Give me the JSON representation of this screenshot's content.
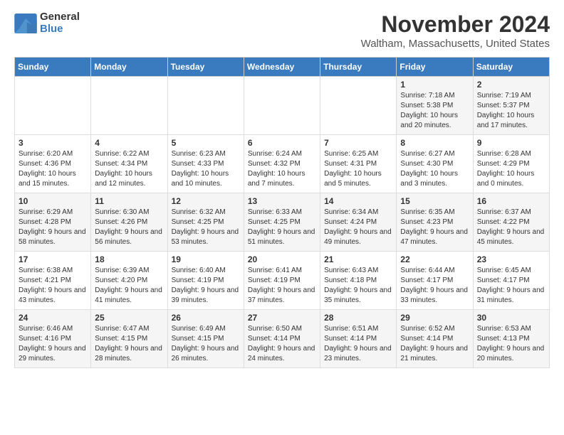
{
  "logo": {
    "general": "General",
    "blue": "Blue"
  },
  "title": "November 2024",
  "location": "Waltham, Massachusetts, United States",
  "days_of_week": [
    "Sunday",
    "Monday",
    "Tuesday",
    "Wednesday",
    "Thursday",
    "Friday",
    "Saturday"
  ],
  "weeks": [
    [
      {
        "num": "",
        "info": ""
      },
      {
        "num": "",
        "info": ""
      },
      {
        "num": "",
        "info": ""
      },
      {
        "num": "",
        "info": ""
      },
      {
        "num": "",
        "info": ""
      },
      {
        "num": "1",
        "info": "Sunrise: 7:18 AM\nSunset: 5:38 PM\nDaylight: 10 hours and 20 minutes."
      },
      {
        "num": "2",
        "info": "Sunrise: 7:19 AM\nSunset: 5:37 PM\nDaylight: 10 hours and 17 minutes."
      }
    ],
    [
      {
        "num": "3",
        "info": "Sunrise: 6:20 AM\nSunset: 4:36 PM\nDaylight: 10 hours and 15 minutes."
      },
      {
        "num": "4",
        "info": "Sunrise: 6:22 AM\nSunset: 4:34 PM\nDaylight: 10 hours and 12 minutes."
      },
      {
        "num": "5",
        "info": "Sunrise: 6:23 AM\nSunset: 4:33 PM\nDaylight: 10 hours and 10 minutes."
      },
      {
        "num": "6",
        "info": "Sunrise: 6:24 AM\nSunset: 4:32 PM\nDaylight: 10 hours and 7 minutes."
      },
      {
        "num": "7",
        "info": "Sunrise: 6:25 AM\nSunset: 4:31 PM\nDaylight: 10 hours and 5 minutes."
      },
      {
        "num": "8",
        "info": "Sunrise: 6:27 AM\nSunset: 4:30 PM\nDaylight: 10 hours and 3 minutes."
      },
      {
        "num": "9",
        "info": "Sunrise: 6:28 AM\nSunset: 4:29 PM\nDaylight: 10 hours and 0 minutes."
      }
    ],
    [
      {
        "num": "10",
        "info": "Sunrise: 6:29 AM\nSunset: 4:28 PM\nDaylight: 9 hours and 58 minutes."
      },
      {
        "num": "11",
        "info": "Sunrise: 6:30 AM\nSunset: 4:26 PM\nDaylight: 9 hours and 56 minutes."
      },
      {
        "num": "12",
        "info": "Sunrise: 6:32 AM\nSunset: 4:25 PM\nDaylight: 9 hours and 53 minutes."
      },
      {
        "num": "13",
        "info": "Sunrise: 6:33 AM\nSunset: 4:25 PM\nDaylight: 9 hours and 51 minutes."
      },
      {
        "num": "14",
        "info": "Sunrise: 6:34 AM\nSunset: 4:24 PM\nDaylight: 9 hours and 49 minutes."
      },
      {
        "num": "15",
        "info": "Sunrise: 6:35 AM\nSunset: 4:23 PM\nDaylight: 9 hours and 47 minutes."
      },
      {
        "num": "16",
        "info": "Sunrise: 6:37 AM\nSunset: 4:22 PM\nDaylight: 9 hours and 45 minutes."
      }
    ],
    [
      {
        "num": "17",
        "info": "Sunrise: 6:38 AM\nSunset: 4:21 PM\nDaylight: 9 hours and 43 minutes."
      },
      {
        "num": "18",
        "info": "Sunrise: 6:39 AM\nSunset: 4:20 PM\nDaylight: 9 hours and 41 minutes."
      },
      {
        "num": "19",
        "info": "Sunrise: 6:40 AM\nSunset: 4:19 PM\nDaylight: 9 hours and 39 minutes."
      },
      {
        "num": "20",
        "info": "Sunrise: 6:41 AM\nSunset: 4:19 PM\nDaylight: 9 hours and 37 minutes."
      },
      {
        "num": "21",
        "info": "Sunrise: 6:43 AM\nSunset: 4:18 PM\nDaylight: 9 hours and 35 minutes."
      },
      {
        "num": "22",
        "info": "Sunrise: 6:44 AM\nSunset: 4:17 PM\nDaylight: 9 hours and 33 minutes."
      },
      {
        "num": "23",
        "info": "Sunrise: 6:45 AM\nSunset: 4:17 PM\nDaylight: 9 hours and 31 minutes."
      }
    ],
    [
      {
        "num": "24",
        "info": "Sunrise: 6:46 AM\nSunset: 4:16 PM\nDaylight: 9 hours and 29 minutes."
      },
      {
        "num": "25",
        "info": "Sunrise: 6:47 AM\nSunset: 4:15 PM\nDaylight: 9 hours and 28 minutes."
      },
      {
        "num": "26",
        "info": "Sunrise: 6:49 AM\nSunset: 4:15 PM\nDaylight: 9 hours and 26 minutes."
      },
      {
        "num": "27",
        "info": "Sunrise: 6:50 AM\nSunset: 4:14 PM\nDaylight: 9 hours and 24 minutes."
      },
      {
        "num": "28",
        "info": "Sunrise: 6:51 AM\nSunset: 4:14 PM\nDaylight: 9 hours and 23 minutes."
      },
      {
        "num": "29",
        "info": "Sunrise: 6:52 AM\nSunset: 4:14 PM\nDaylight: 9 hours and 21 minutes."
      },
      {
        "num": "30",
        "info": "Sunrise: 6:53 AM\nSunset: 4:13 PM\nDaylight: 9 hours and 20 minutes."
      }
    ]
  ]
}
